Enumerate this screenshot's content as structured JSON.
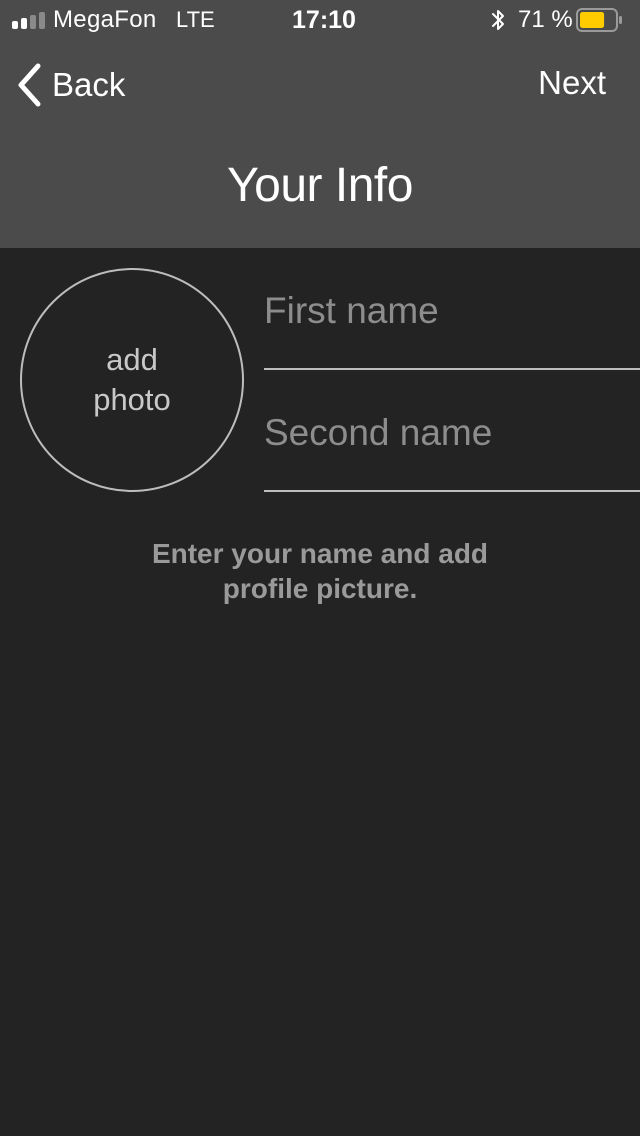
{
  "status_bar": {
    "carrier": "MegaFon",
    "network": "LTE",
    "time": "17:10",
    "battery_percent": "71 %",
    "battery_level": 0.71,
    "signal_bars_active": 2,
    "signal_bars_total": 4,
    "battery_color": "#ffcc00",
    "icons": [
      "signal-icon",
      "bluetooth-icon",
      "battery-icon"
    ]
  },
  "nav": {
    "back_label": "Back",
    "next_label": "Next",
    "back_icon": "chevron-left-icon"
  },
  "page": {
    "title": "Your Info"
  },
  "photo": {
    "line1": "add",
    "line2": "photo"
  },
  "form": {
    "first_name_placeholder": "First name",
    "first_name_value": "",
    "second_name_placeholder": "Second name",
    "second_name_value": ""
  },
  "hint": {
    "line1": "Enter your name and add",
    "line2": "profile picture."
  },
  "colors": {
    "header_bg": "#4b4b4b",
    "body_bg": "#232323",
    "text": "#ffffff",
    "placeholder": "#8d8d8d",
    "hint": "#9a9a9a"
  }
}
